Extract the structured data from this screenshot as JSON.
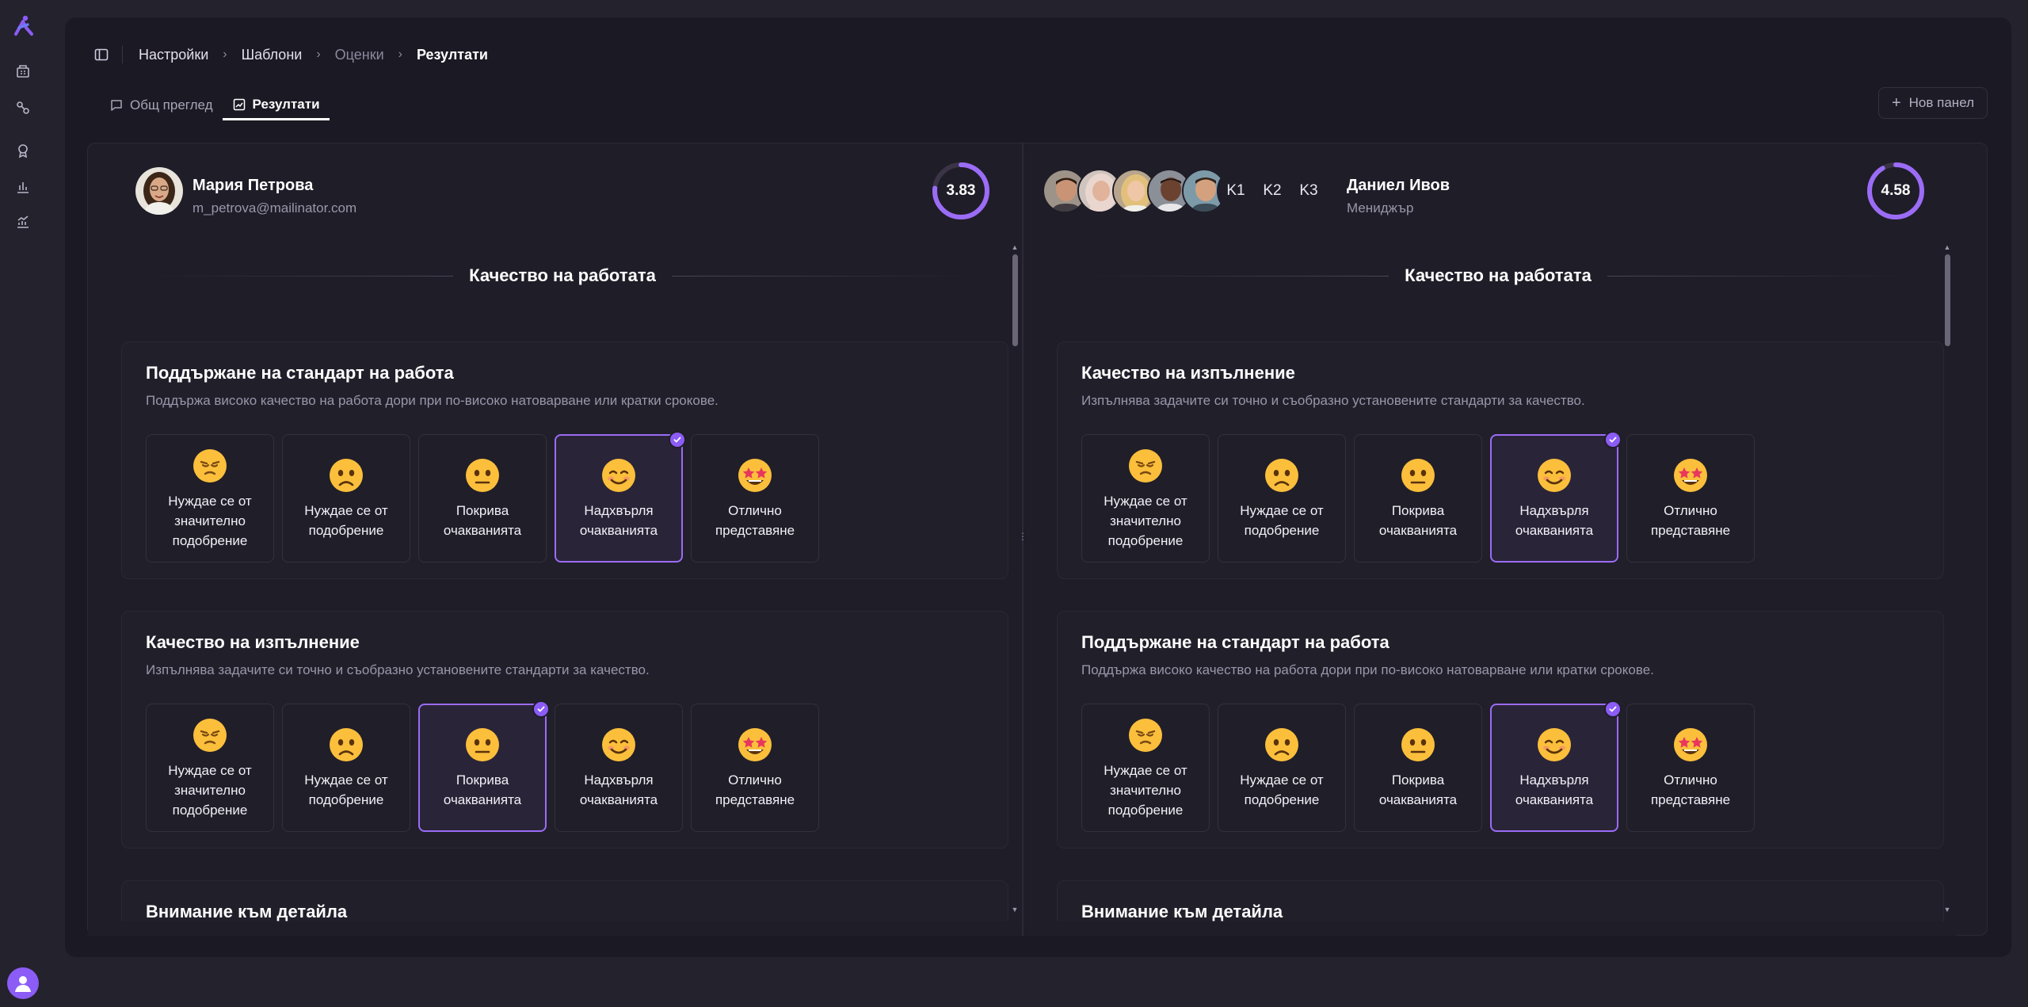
{
  "breadcrumb": {
    "items": [
      "Настройки",
      "Шаблони",
      "Оценки",
      "Резултати"
    ]
  },
  "tabs": {
    "overview": "Общ преглед",
    "results": "Резултати"
  },
  "new_panel_label": "Нов панел",
  "left_panel": {
    "user": {
      "name": "Мария Петрова",
      "email": "m_petrova@mailinator.com"
    },
    "score": "3.83",
    "score_fraction": 0.766,
    "section_title": "Качество на работата",
    "criteria": [
      {
        "title": "Поддържане на стандарт на работа",
        "description": "Поддържа високо качество на работа дори при по-високо натоварване или кратки срокове.",
        "selected_index": 3
      },
      {
        "title": "Качество на изпълнение",
        "description": "Изпълнява задачите си точно и съобразно установените стандарти за качество.",
        "selected_index": 2
      }
    ],
    "next_criterion_title": "Внимание към детайла"
  },
  "right_panel": {
    "user": {
      "name": "Даниел Ивов",
      "role": "Мениджър"
    },
    "score": "4.58",
    "score_fraction": 0.916,
    "badges": [
      "K1",
      "K2",
      "K3"
    ],
    "section_title": "Качество на работата",
    "criteria": [
      {
        "title": "Качество на изпълнение",
        "description": "Изпълнява задачите си точно и съобразно установените стандарти за качество.",
        "selected_index": 3
      },
      {
        "title": "Поддържане на стандарт на работа",
        "description": "Поддържа високо качество на работа дори при по-високо натоварване или кратки срокове.",
        "selected_index": 3
      }
    ],
    "next_criterion_title": "Внимание към детайла"
  },
  "rating_options": [
    {
      "label": "Нуждае се от\nзначително\nподобрение",
      "emoji": "disappointed-face-icon"
    },
    {
      "label": "Нуждае се от\nподобрение",
      "emoji": "frowning-face-icon"
    },
    {
      "label": "Покрива\nочакванията",
      "emoji": "neutral-face-icon"
    },
    {
      "label": "Надхвърля\nочакванията",
      "emoji": "smiling-face-icon"
    },
    {
      "label": "Отлично\nпредставяне",
      "emoji": "star-struck-icon"
    }
  ],
  "colors": {
    "accent": "#8b5cf6",
    "background": "#24222d",
    "card": "#1b1923"
  }
}
